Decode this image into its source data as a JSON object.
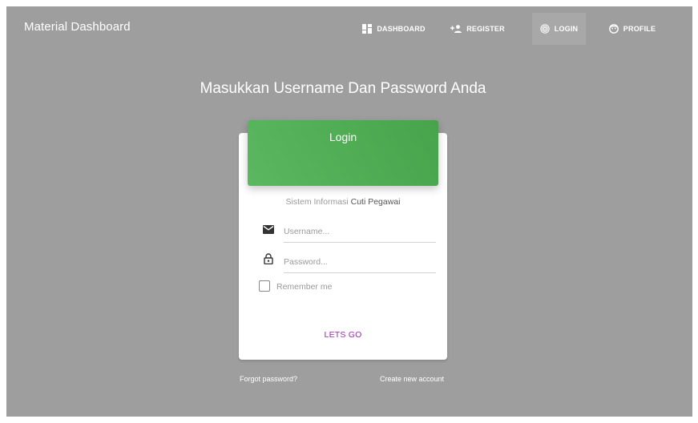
{
  "navbar": {
    "brand": "Material Dashboard",
    "items": [
      {
        "label": "DASHBOARD",
        "icon": "dashboard-icon"
      },
      {
        "label": "REGISTER",
        "icon": "person-add-icon"
      },
      {
        "label": "LOGIN",
        "icon": "fingerprint-icon",
        "active": true
      },
      {
        "label": "PROFILE",
        "icon": "face-icon"
      }
    ]
  },
  "main": {
    "heading": "Masukkan Username Dan Password Anda"
  },
  "card": {
    "header_title": "Login",
    "subtitle_prefix": "Sistem Informasi",
    "subtitle_strong": "Cuti Pegawai",
    "username_placeholder": "Username...",
    "password_placeholder": "Password...",
    "remember_label": "Remember me",
    "submit_label": "LETS GO"
  },
  "footer": {
    "forgot": "Forgot password?",
    "create": "Create new account"
  },
  "colors": {
    "background": "#9e9e9e",
    "header_green": "#4caf50",
    "submit_purple": "#9c27b0"
  }
}
